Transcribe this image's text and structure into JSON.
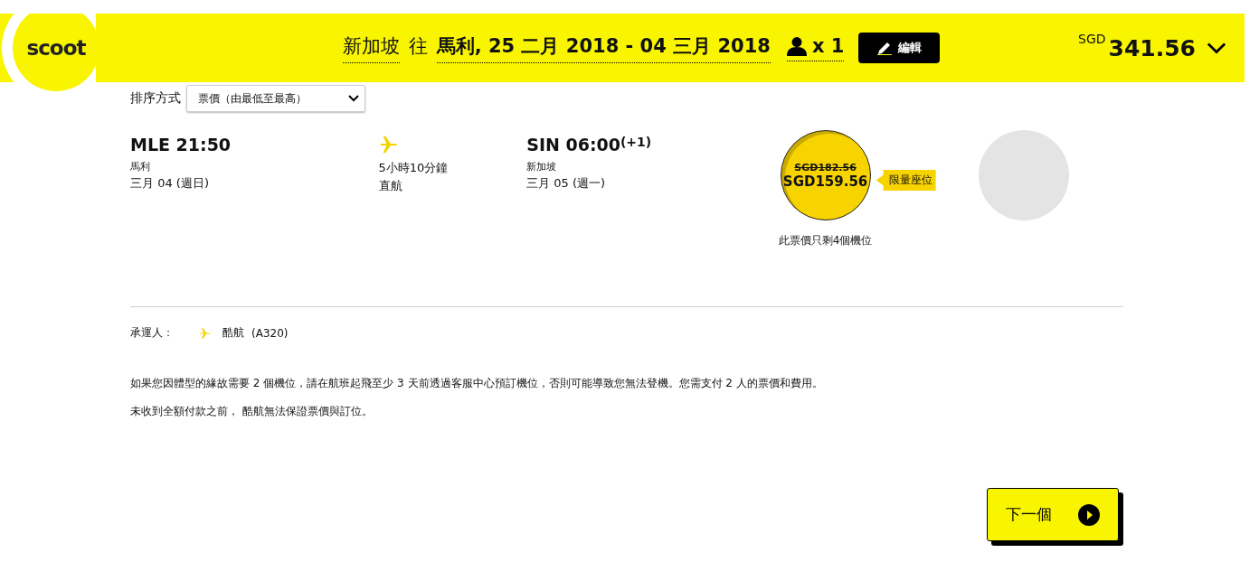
{
  "header": {
    "logo": "scoot",
    "origin": "新加坡",
    "to_word": "往",
    "route_dates": "馬利, 25 二月 2018 - 04 三月 2018",
    "passengers": "x 1",
    "edit_button": "編輯",
    "currency": "SGD",
    "total": "341.56"
  },
  "sort": {
    "label": "排序方式",
    "value": "票價（由最低至最高）"
  },
  "flight": {
    "depart": "MLE 21:50",
    "depart_city": "馬利",
    "depart_date": "三月 04 (週日)",
    "duration": "5小時10分鐘",
    "stops": "直航",
    "arrive": "SIN 06:00",
    "arrive_plus": "(+1)",
    "arrive_city": "新加坡",
    "arrive_date": "三月 05 (週一)"
  },
  "fares": [
    {
      "kind": "available",
      "old_price": "SGD182.56",
      "price": "SGD159.56",
      "tag": "限量座位",
      "note": "此票價只剩4個機位"
    },
    {
      "kind": "unavailable"
    }
  ],
  "carrier": {
    "label": "承運人：",
    "name": "酷航",
    "aircraft": "(A320)"
  },
  "notes": [
    "如果您因體型的緣故需要 2 個機位，請在航班起飛至少 3 天前透過客服中心預訂機位，否則可能導致您無法登機。您需支付 2 人的票價和費用。",
    "未收到全額付款之前， 酷航無法保證票價與訂位。"
  ],
  "next_button": "下一個"
}
